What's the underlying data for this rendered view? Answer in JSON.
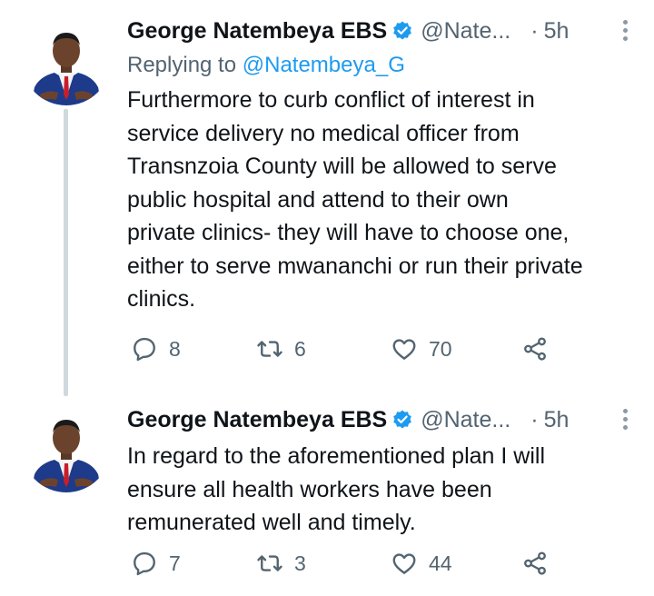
{
  "tweets": [
    {
      "author_name": "George Natembeya EBS",
      "handle": "@Nate...",
      "separator": "·",
      "time": "5h",
      "reply_prefix": "Replying to",
      "reply_mention": "@Natembeya_G",
      "body_lines": [
        "Furthermore to curb conflict of interest in",
        "service delivery no medical officer from",
        "Transnzoia County will be allowed to serve",
        "public hospital and attend to their own",
        "private clinics- they will have to choose one,",
        "either to serve mwananchi or run their private",
        "clinics."
      ],
      "replies": "8",
      "retweets": "6",
      "likes": "70"
    },
    {
      "author_name": "George Natembeya EBS",
      "handle": "@Nate...",
      "separator": "·",
      "time": "5h",
      "body_lines": [
        "In regard to the aforementioned plan I  will",
        "ensure all health workers have been",
        "remunerated well and timely."
      ],
      "replies": "7",
      "retweets": "3",
      "likes": "44"
    }
  ],
  "colors": {
    "text": "#0f1419",
    "secondary": "#536471",
    "link": "#1d9bf0",
    "verified": "#1d9bf0",
    "thread_line": "#cfd9de"
  },
  "icons": [
    "verified-badge-icon",
    "more-icon",
    "reply-icon",
    "retweet-icon",
    "like-icon",
    "share-icon"
  ]
}
